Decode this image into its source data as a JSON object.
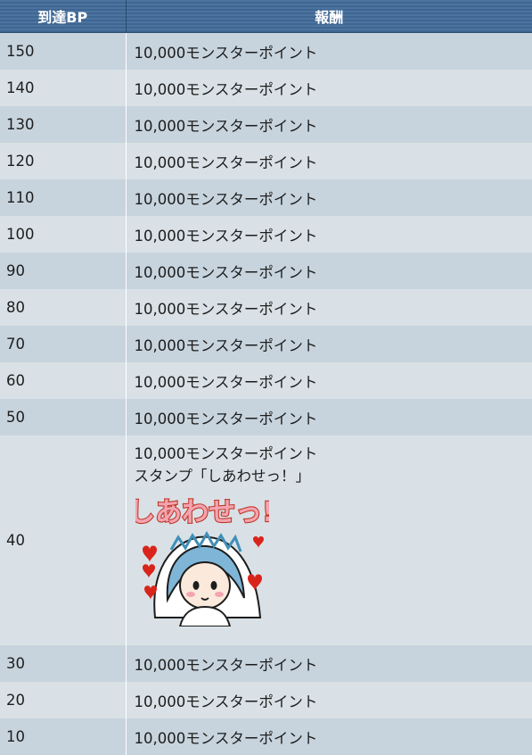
{
  "header": {
    "bp_label": "到達BP",
    "reward_label": "報酬"
  },
  "rows": [
    {
      "bp": "150",
      "reward": "10,000モンスターポイント"
    },
    {
      "bp": "140",
      "reward": "10,000モンスターポイント"
    },
    {
      "bp": "130",
      "reward": "10,000モンスターポイント"
    },
    {
      "bp": "120",
      "reward": "10,000モンスターポイント"
    },
    {
      "bp": "110",
      "reward": "10,000モンスターポイント"
    },
    {
      "bp": "100",
      "reward": "10,000モンスターポイント"
    },
    {
      "bp": "90",
      "reward": "10,000モンスターポイント"
    },
    {
      "bp": "80",
      "reward": "10,000モンスターポイント"
    },
    {
      "bp": "70",
      "reward": "10,000モンスターポイント"
    },
    {
      "bp": "60",
      "reward": "10,000モンスターポイント"
    },
    {
      "bp": "50",
      "reward": "10,000モンスターポイント"
    },
    {
      "bp": "40",
      "reward": "10,000モンスターポイント",
      "reward2": "スタンプ「しあわせっ！」",
      "stamp_text": "しあわせっ!"
    },
    {
      "bp": "30",
      "reward": "10,000モンスターポイント"
    },
    {
      "bp": "20",
      "reward": "10,000モンスターポイント"
    },
    {
      "bp": "10",
      "reward": "10,000モンスターポイント"
    }
  ],
  "colors": {
    "header_blue": "#456c98",
    "row_dark": "#c7d4de",
    "row_light": "#d9e1e6",
    "stamp_text_fill": "#f4a4b0",
    "stamp_text_outline": "#c0392b",
    "heart": "#d9241b",
    "hair": "#7fb6d8"
  }
}
